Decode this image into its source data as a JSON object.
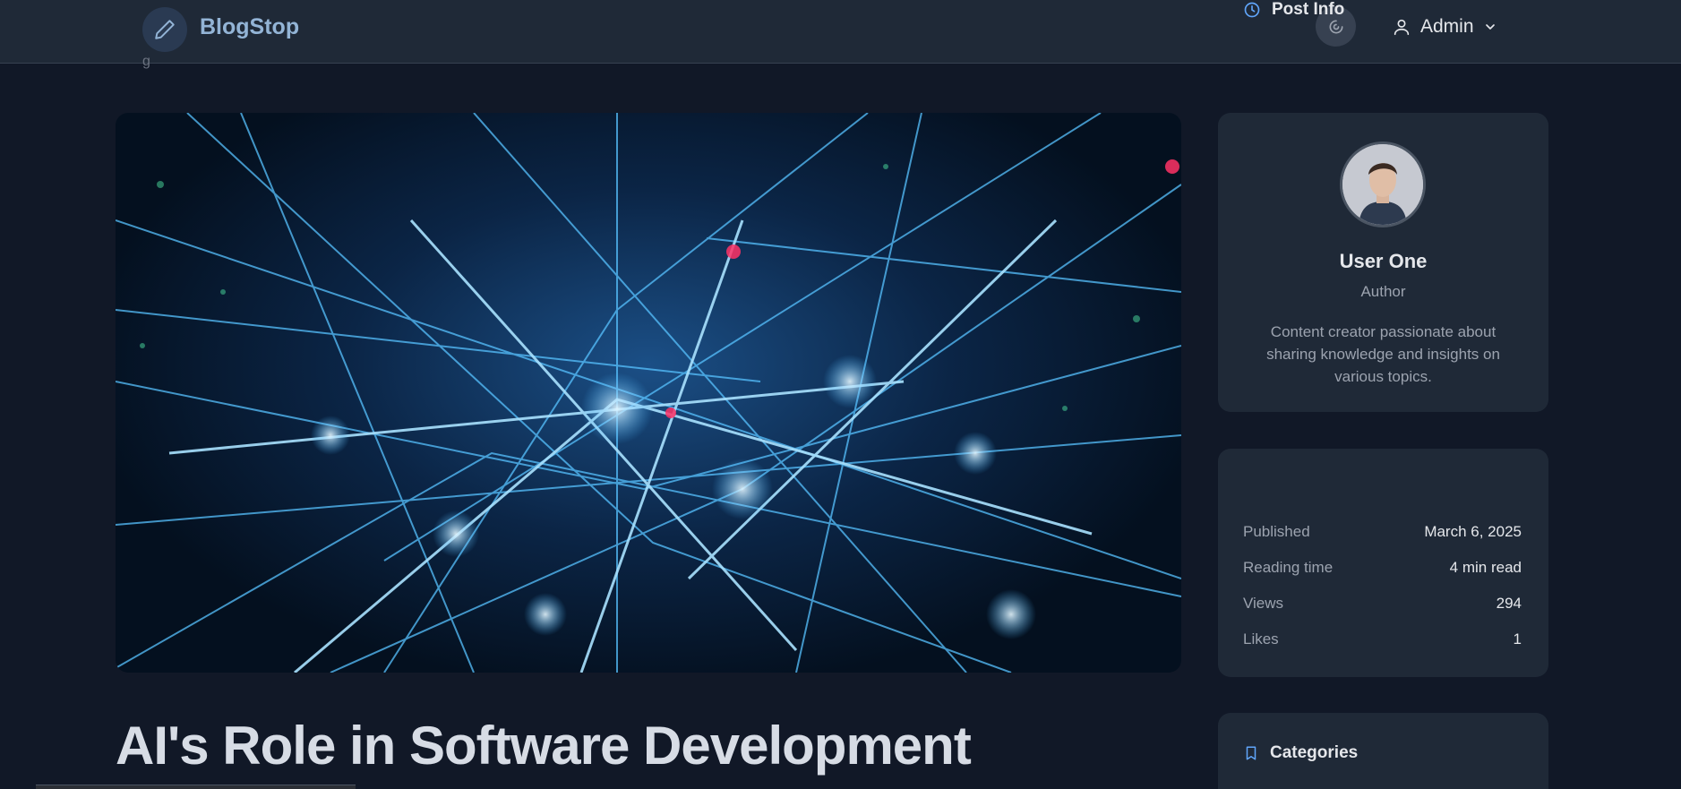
{
  "header": {
    "brand": "BlogStop",
    "user_label": "Admin"
  },
  "breadcrumb_sliver": "g",
  "post": {
    "title": "AI's Role in Software Development"
  },
  "author": {
    "name": "User One",
    "role": "Author",
    "bio": "Content creator passionate about sharing knowledge and insights on various topics."
  },
  "post_info": {
    "heading": "Post Info",
    "rows": [
      {
        "label": "Published",
        "value": "March 6, 2025"
      },
      {
        "label": "Reading time",
        "value": "4 min read"
      },
      {
        "label": "Views",
        "value": "294"
      },
      {
        "label": "Likes",
        "value": "1"
      }
    ]
  },
  "categories": {
    "heading": "Categories"
  },
  "icons": {
    "logo": "pencil-icon",
    "theme": "theme-toggle-icon",
    "user": "user-icon",
    "dropdown": "chevron-down-icon",
    "post_info": "clock-icon",
    "categories": "bookmark-icon"
  },
  "colors": {
    "background": "#111827",
    "header": "#1f2937",
    "card": "#1f2937",
    "brand_text": "#93b4d6",
    "accent": "#60a5fa"
  }
}
